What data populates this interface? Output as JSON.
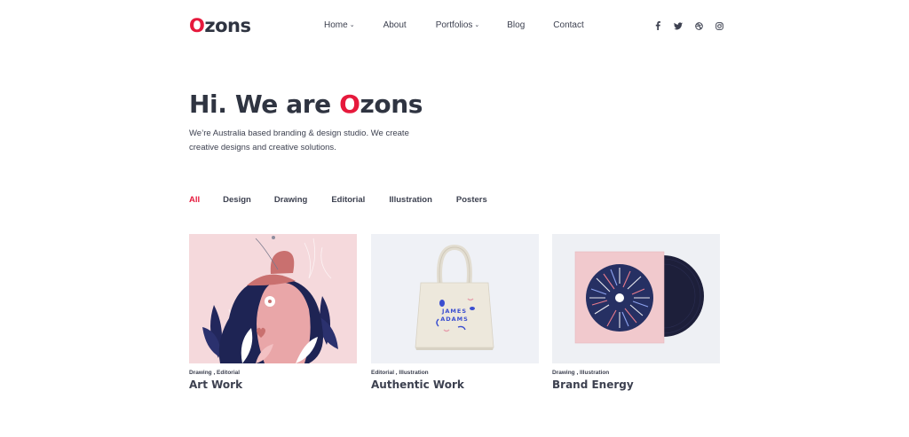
{
  "brand": {
    "logo_first": "O",
    "logo_rest": "zons",
    "accent": "#e6193c"
  },
  "nav": {
    "items": [
      {
        "label": "Home",
        "dropdown": true
      },
      {
        "label": "About",
        "dropdown": false
      },
      {
        "label": "Portfolios",
        "dropdown": true
      },
      {
        "label": "Blog",
        "dropdown": false
      },
      {
        "label": "Contact",
        "dropdown": false
      }
    ]
  },
  "social": [
    "facebook-icon",
    "twitter-icon",
    "dribbble-icon",
    "instagram-icon"
  ],
  "hero": {
    "title_prefix": "Hi. We are ",
    "title_accent": "O",
    "title_suffix": "zons",
    "desc_line1": "We’re Australia based branding & design studio. We create",
    "desc_line2": "creative designs and creative solutions."
  },
  "filters": [
    "All",
    "Design",
    "Drawing",
    "Editorial",
    "Illustration",
    "Posters"
  ],
  "filter_active": "All",
  "cards": [
    {
      "cats": "Drawing , Editorial",
      "title": "Art Work"
    },
    {
      "cats": "Editorial , Illustration",
      "title": "Authentic Work",
      "bag_text_1": "JAMES",
      "bag_text_2": "ADAMS"
    },
    {
      "cats": "Drawing , Illustration",
      "title": "Brand Energy"
    }
  ]
}
